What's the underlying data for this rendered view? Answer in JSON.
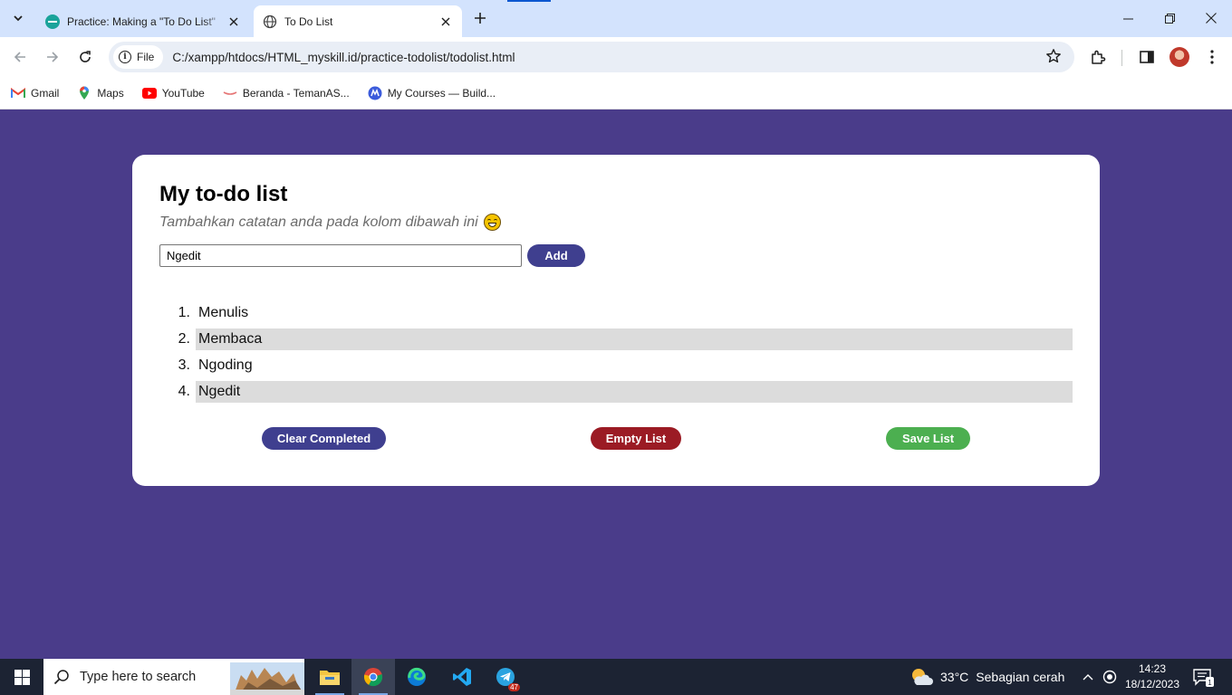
{
  "browser": {
    "tabs": [
      {
        "title": "Practice: Making a \"To Do List\" ",
        "active": false
      },
      {
        "title": "To Do List",
        "active": true
      }
    ],
    "address": {
      "scheme_chip": "File",
      "url": "C:/xampp/htdocs/HTML_myskill.id/practice-todolist/todolist.html"
    },
    "bookmarks": [
      {
        "label": "Gmail",
        "icon": "gmail-icon"
      },
      {
        "label": "Maps",
        "icon": "maps-icon"
      },
      {
        "label": "YouTube",
        "icon": "youtube-icon"
      },
      {
        "label": "Beranda - TemanAS...",
        "icon": "temanas-icon"
      },
      {
        "label": "My Courses — Build...",
        "icon": "courses-icon"
      }
    ]
  },
  "app": {
    "title": "My to-do list",
    "subtitle": "Tambahkan catatan anda pada kolom dibawah ini",
    "input_value": "Ngedit",
    "add_label": "Add",
    "items": [
      {
        "num": "1.",
        "text": "Menulis",
        "shaded": false
      },
      {
        "num": "2.",
        "text": "Membaca",
        "shaded": true
      },
      {
        "num": "3.",
        "text": "Ngoding",
        "shaded": false
      },
      {
        "num": "4.",
        "text": "Ngedit",
        "shaded": true
      }
    ],
    "clear_label": "Clear Completed",
    "empty_label": "Empty List",
    "save_label": "Save List",
    "colors": {
      "background": "#4a3c8a",
      "primary_button": "#3f3f8f",
      "danger_button": "#9b1b24",
      "success_button": "#4caf50",
      "shade": "#dcdcdc"
    }
  },
  "taskbar": {
    "search_placeholder": "Type here to search",
    "weather_temp": "33°C",
    "weather_desc": "Sebagian cerah",
    "time": "14:23",
    "date": "18/12/2023",
    "telegram_badge": "47",
    "notification_count": "1"
  }
}
